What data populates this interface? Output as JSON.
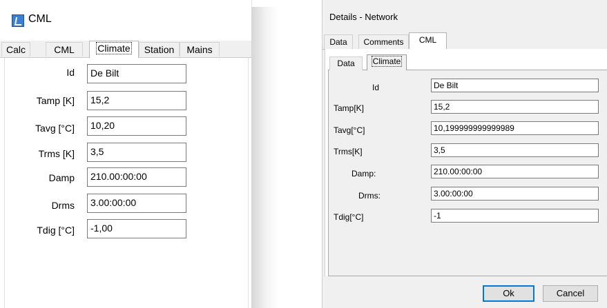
{
  "left_window": {
    "title": "CML",
    "icon": "app-icon",
    "tabs": [
      "Calc",
      "CML",
      "Climate",
      "Station",
      "Mains"
    ],
    "active_tab": "Climate",
    "fields": [
      {
        "label": "Id",
        "value": "De Bilt"
      },
      {
        "label": "Tamp [K]",
        "value": "15,2"
      },
      {
        "label": "Tavg [°C]",
        "value": "10,20"
      },
      {
        "label": "Trms [K]",
        "value": "3,5"
      },
      {
        "label": "Damp",
        "value": "210.00:00:00"
      },
      {
        "label": "Drms",
        "value": "3.00:00:00"
      },
      {
        "label": "Tdig [°C]",
        "value": "-1,00"
      }
    ]
  },
  "right_dialog": {
    "title": "Details - Network",
    "tabs": [
      "Data",
      "Comments",
      "CML"
    ],
    "active_tab": "CML",
    "subtabs": [
      "Data",
      "Climate"
    ],
    "active_subtab": "Climate",
    "fields": [
      {
        "label": "Id",
        "value": "De Bilt"
      },
      {
        "label": "Tamp[K]",
        "value": "15,2"
      },
      {
        "label": "Tavg[°C]",
        "value": "10,199999999999989"
      },
      {
        "label": "Trms[K]",
        "value": "3,5"
      },
      {
        "label": "Damp:",
        "value": "210.00:00:00"
      },
      {
        "label": "Drms:",
        "value": "3.00:00:00"
      },
      {
        "label": "Tdig[°C]",
        "value": "-1"
      }
    ],
    "ok_label": "Ok",
    "cancel_label": "Cancel"
  },
  "colors": {
    "accent": "#0078d7",
    "app_icon": "#3b7fd3"
  }
}
